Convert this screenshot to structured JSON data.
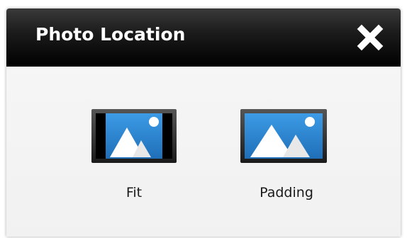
{
  "dialog": {
    "title": "Photo Location",
    "close_icon": "close-x-icon"
  },
  "options": [
    {
      "label": "Fit",
      "icon": "photo-fit-icon"
    },
    {
      "label": "Padding",
      "icon": "photo-padding-icon"
    }
  ],
  "colors": {
    "titlebar": "#000000",
    "title_text": "#ffffff",
    "photo_sky": "#2f86d2",
    "photo_frame": "#2b2b2b"
  }
}
